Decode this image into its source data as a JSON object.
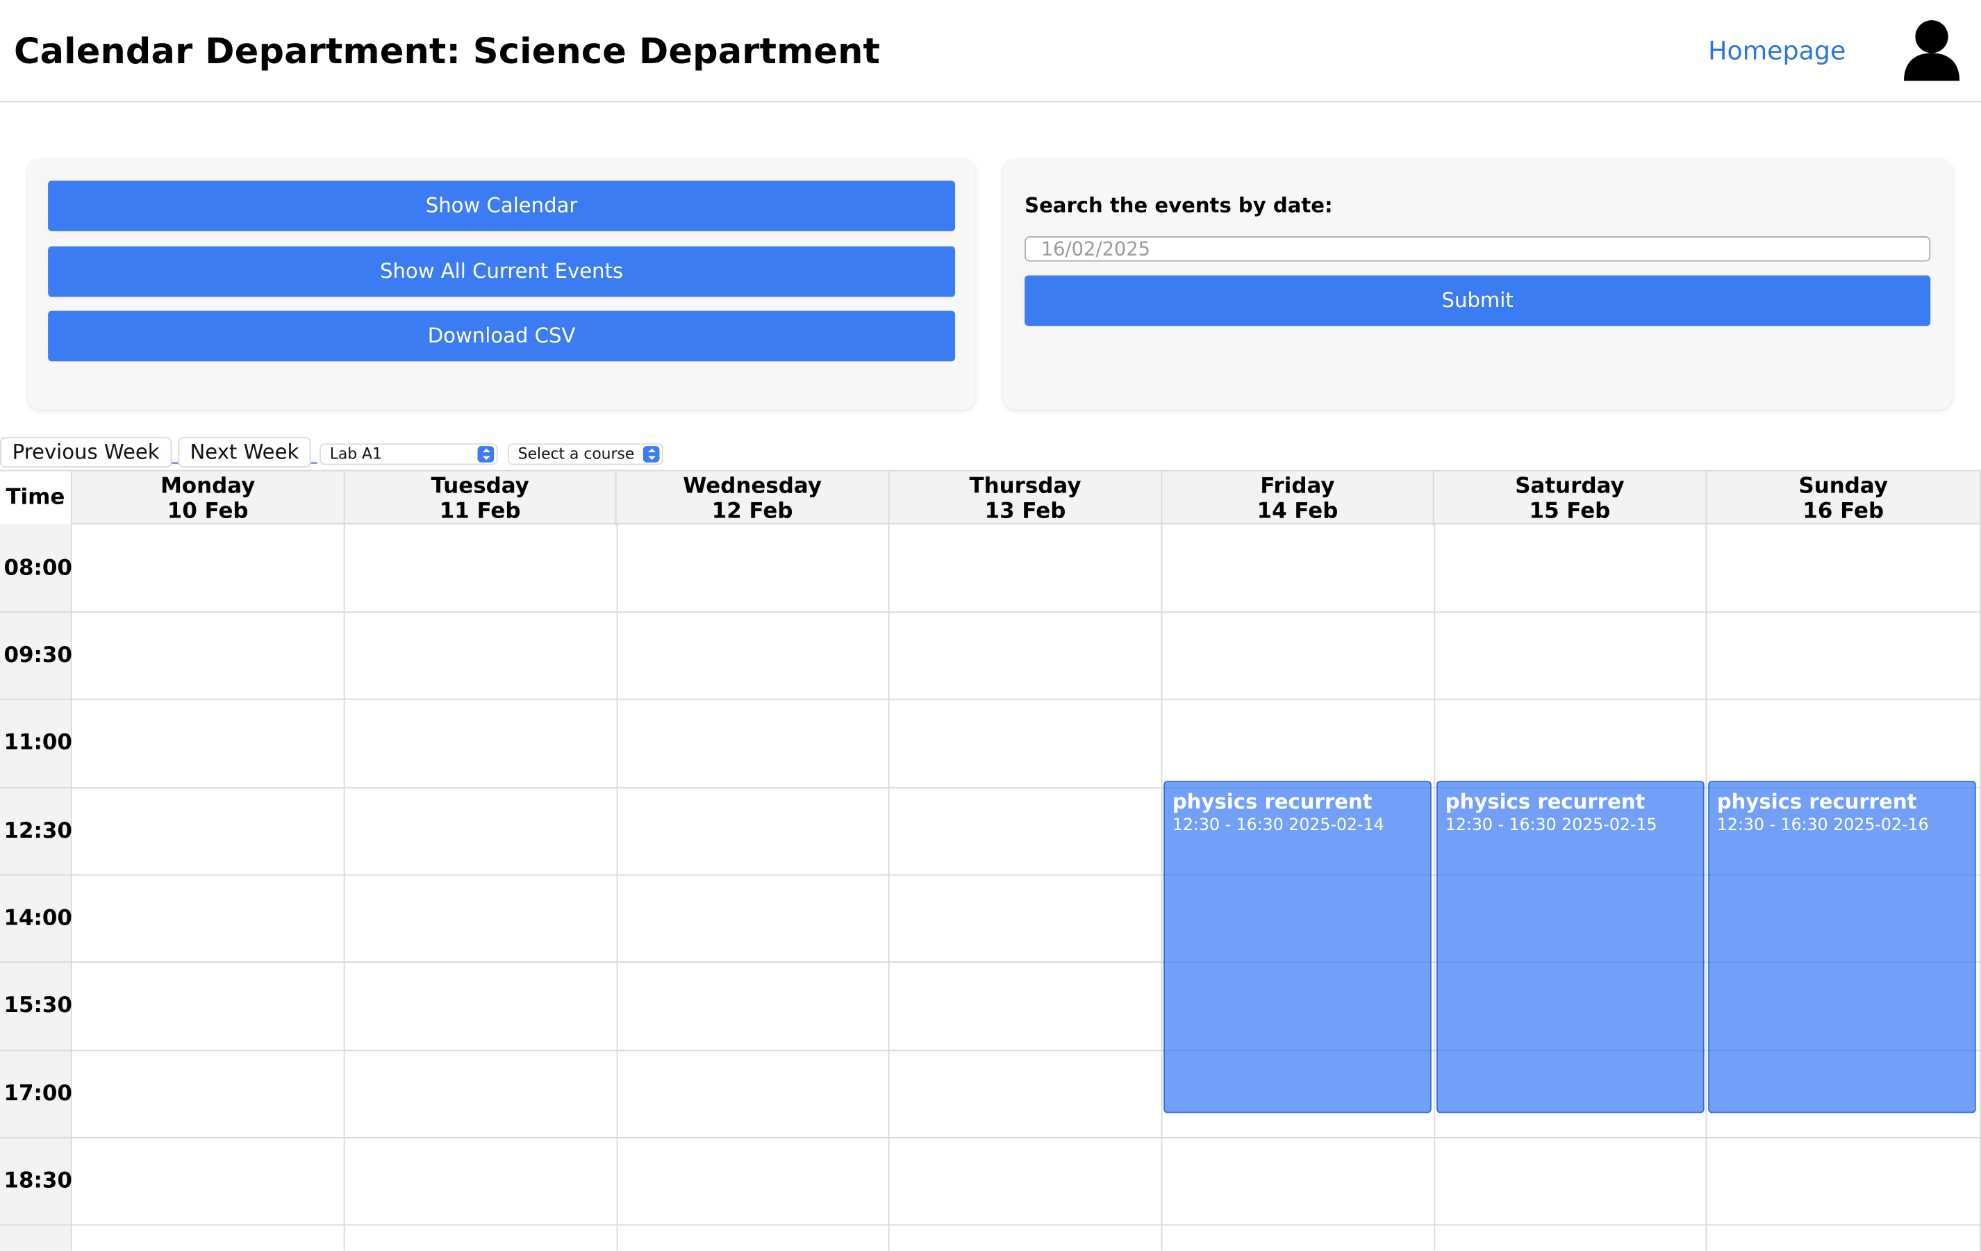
{
  "header": {
    "title": "Calendar Department: Science Department",
    "home_link": "Homepage"
  },
  "actions": {
    "show_calendar": "Show Calendar",
    "show_all_events": "Show All Current Events",
    "download_csv": "Download CSV"
  },
  "search": {
    "label": "Search the events by date:",
    "date_value": "16/02/2025",
    "submit_label": "Submit"
  },
  "controls": {
    "previous_week": "Previous Week",
    "next_week": "Next Week",
    "room_select": "Lab A1",
    "course_select": "Select a course"
  },
  "calendar": {
    "time_header": "Time",
    "days": [
      {
        "name": "Monday",
        "date": "10 Feb"
      },
      {
        "name": "Tuesday",
        "date": "11 Feb"
      },
      {
        "name": "Wednesday",
        "date": "12 Feb"
      },
      {
        "name": "Thursday",
        "date": "13 Feb"
      },
      {
        "name": "Friday",
        "date": "14 Feb"
      },
      {
        "name": "Saturday",
        "date": "15 Feb"
      },
      {
        "name": "Sunday",
        "date": "16 Feb"
      }
    ],
    "time_slots": [
      "08:00",
      "09:30",
      "11:00",
      "12:30",
      "14:00",
      "15:30",
      "17:00",
      "18:30"
    ],
    "events": [
      {
        "day": "Friday",
        "title": "physics recurrent",
        "details": "12:30 - 16:30 2025-02-14"
      },
      {
        "day": "Saturday",
        "title": "physics recurrent",
        "details": "12:30 - 16:30 2025-02-15"
      },
      {
        "day": "Sunday",
        "title": "physics recurrent",
        "details": "12:30 - 16:30 2025-02-16"
      }
    ]
  },
  "colors": {
    "primary_button": "#3b7cf2",
    "link": "#2a77e0",
    "event_fill": "#6b9ff5"
  },
  "icons": {
    "user": "user-avatar-icon",
    "select_arrows": "select-arrows-icon"
  }
}
